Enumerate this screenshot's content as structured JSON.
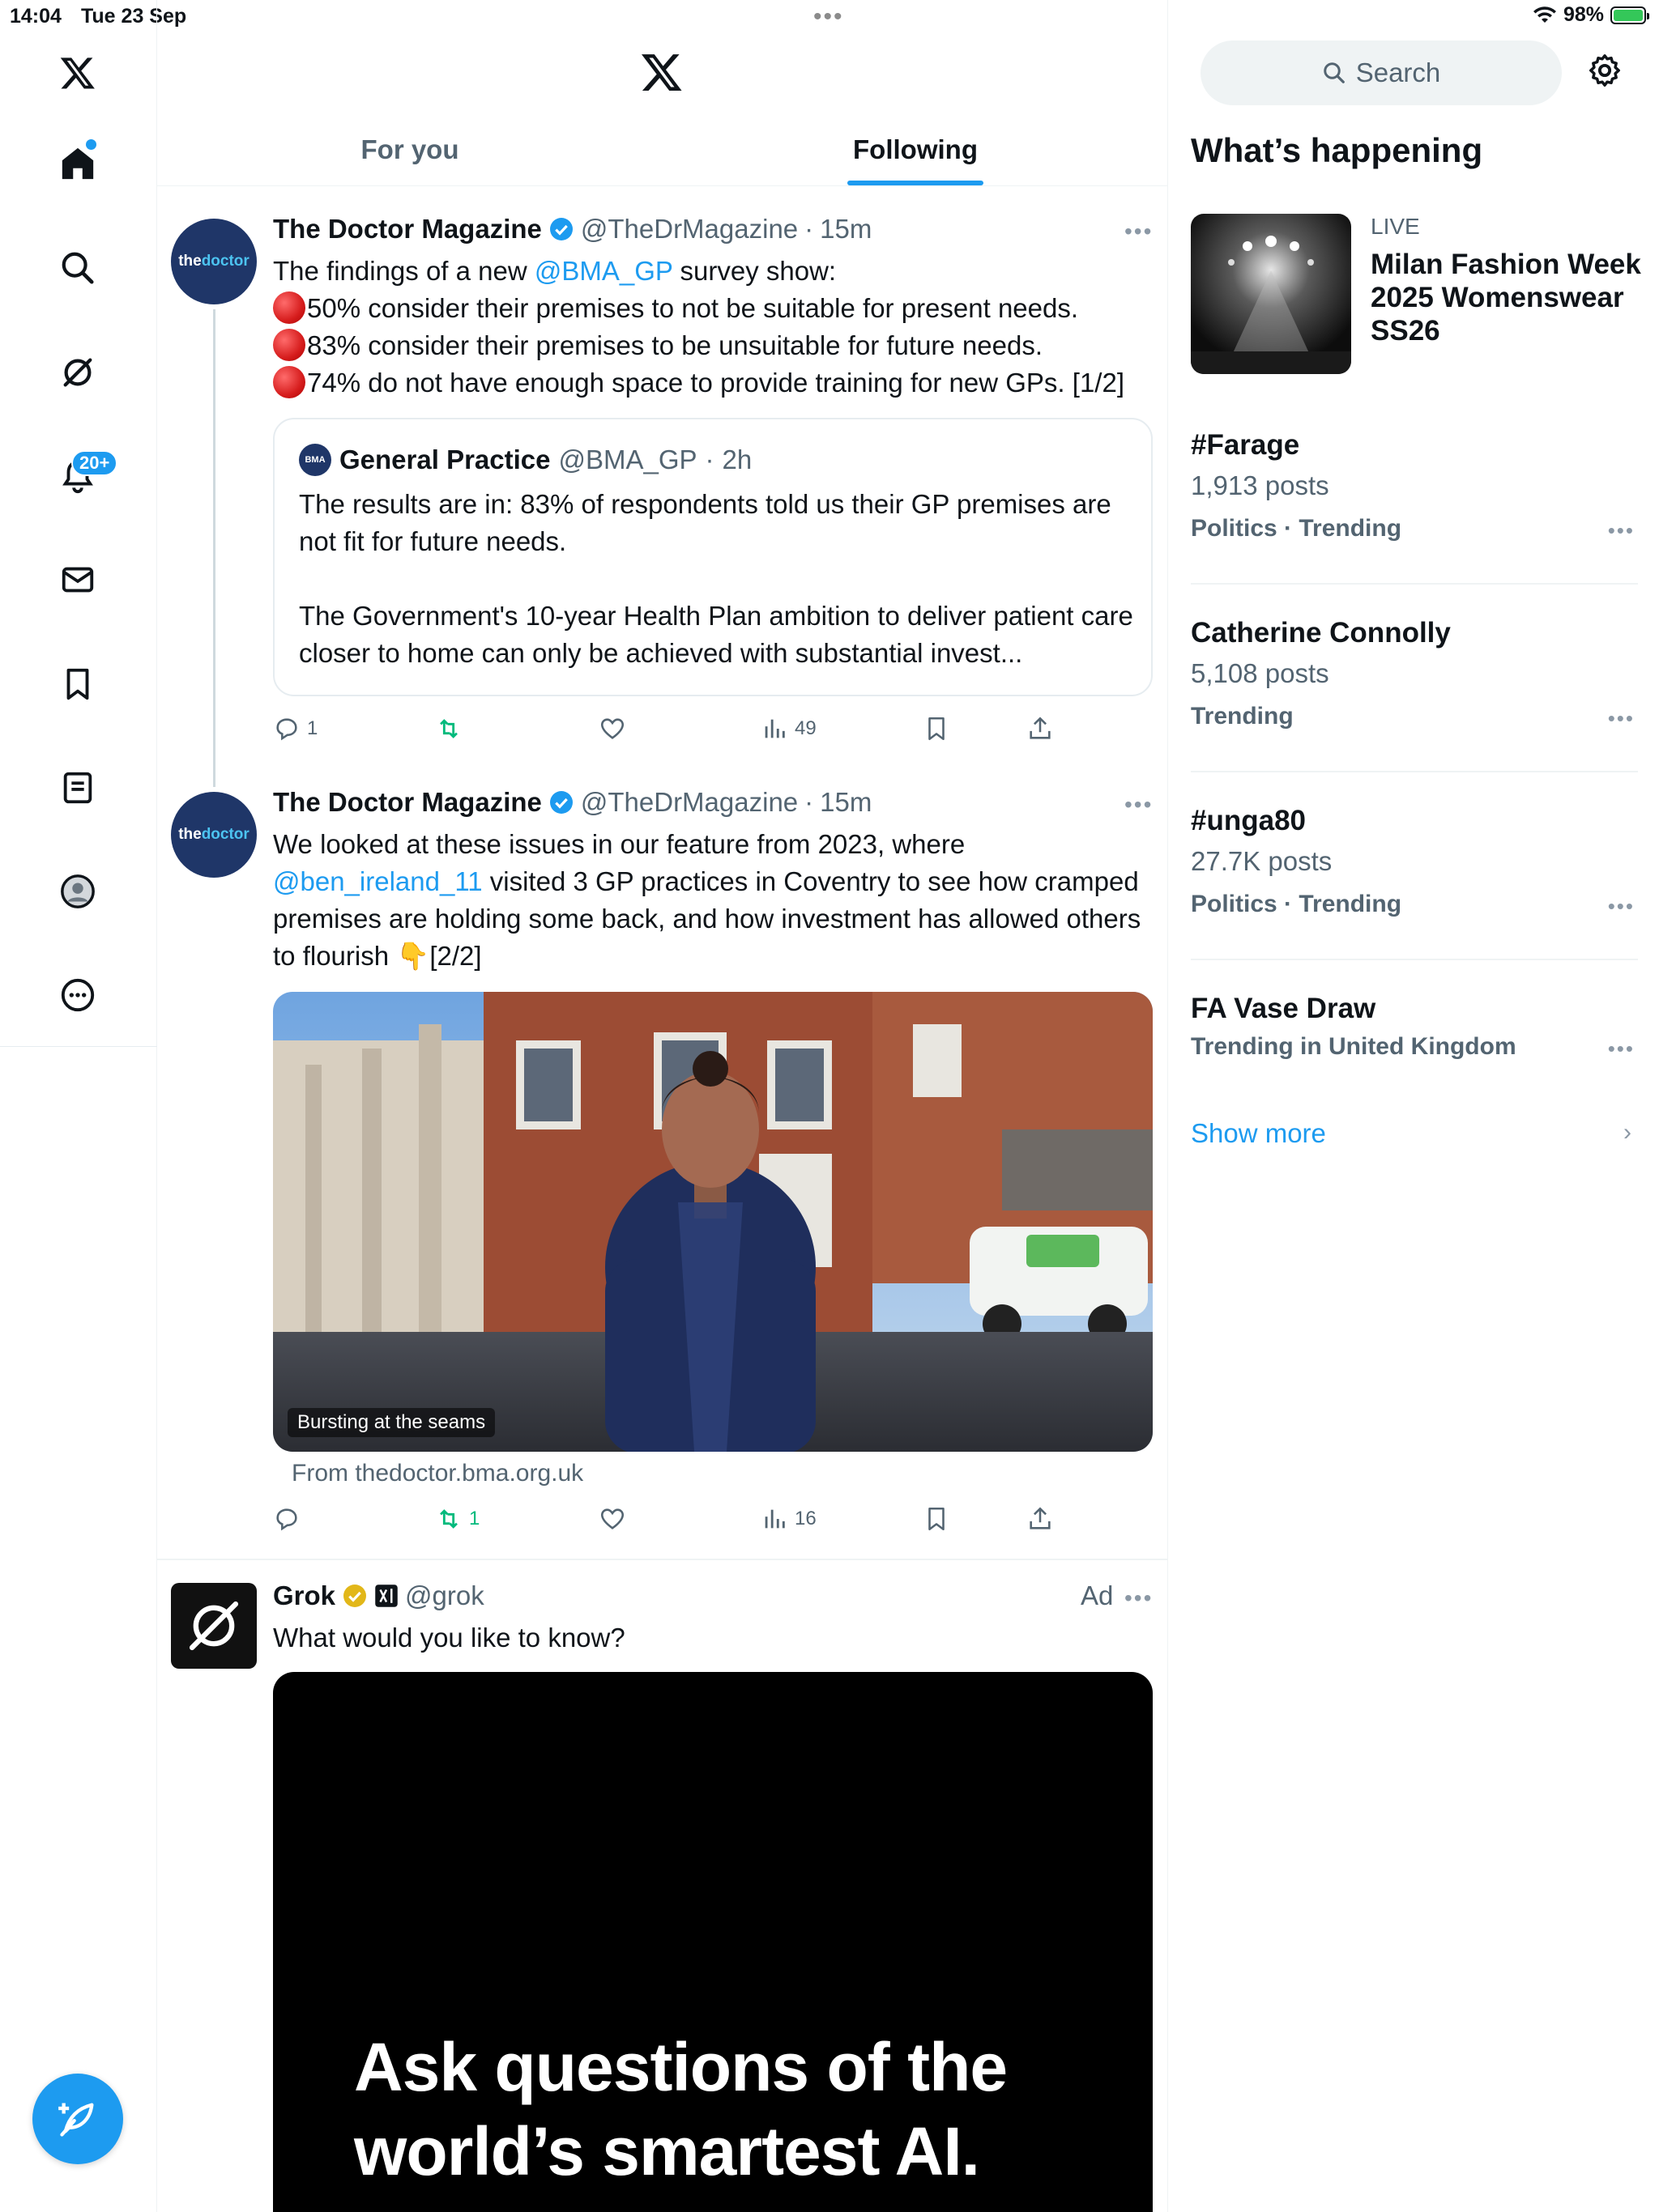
{
  "status": {
    "time": "14:04",
    "date": "Tue 23 Sep",
    "battery": "98%"
  },
  "nav": {
    "notifications_badge": "20+"
  },
  "tabs": [
    {
      "label": "For you"
    },
    {
      "label": "Following"
    }
  ],
  "tweet1": {
    "name": "The Doctor Magazine",
    "handle": "@TheDrMagazine",
    "time": "15m",
    "avatar_text_a": "the",
    "avatar_text_b": "doctor",
    "intro_a": "The findings of a new ",
    "intro_mention": "@BMA_GP",
    "intro_b": " survey show:",
    "line1": "50% consider their premises to not be suitable for present needs.",
    "line2": "83% consider their premises to be unsuitable for future needs.",
    "line3": "74% do not have enough space to provide training for new GPs. [1/2]",
    "quote": {
      "logo": "BMA",
      "name": "General Practice",
      "handle": "@BMA_GP",
      "time": "2h",
      "para1": "The results are in: 83% of respondents told us their GP premises are not fit for future needs.",
      "para2": "The Government's 10-year Health Plan ambition to deliver patient care closer to home can only be achieved with substantial invest..."
    },
    "replies": "1",
    "views": "49"
  },
  "tweet2": {
    "name": "The Doctor Magazine",
    "handle": "@TheDrMagazine",
    "time": "15m",
    "text_a": "We looked at these issues in our feature from 2023, where ",
    "mention": "@ben_ireland_11",
    "text_b": " visited 3 GP practices in Coventry to see how cramped premises are holding some back, and how investment has allowed others to flourish 👇[2/2]",
    "image_caption": "Bursting at the seams",
    "source": "From thedoctor.bma.org.uk",
    "reposts": "1",
    "views": "16"
  },
  "ad": {
    "name": "Grok",
    "handle": "@grok",
    "label": "Ad",
    "text": "What would you like to know?",
    "headline_1": "Ask questions of the",
    "headline_2": "world’s smartest AI."
  },
  "sidebar": {
    "search_placeholder": "Search",
    "title": "What’s happening",
    "live": {
      "label": "LIVE",
      "title": "Milan Fashion Week 2025 Womenswear SS26"
    },
    "trends": [
      {
        "title": "#Farage",
        "posts": "1,913 posts",
        "category": "Politics · Trending"
      },
      {
        "title": "Catherine Connolly",
        "posts": "5,108 posts",
        "category": "Trending"
      },
      {
        "title": "#unga80",
        "posts": "27.7K posts",
        "category": "Politics · Trending"
      },
      {
        "title": "FA Vase Draw",
        "posts": "",
        "category": "Trending in United Kingdom"
      }
    ],
    "show_more": "Show more"
  },
  "colors": {
    "accent": "#1d9bf0",
    "repost_green": "#00ba7c",
    "text_secondary": "#536471"
  },
  "icons": [
    "x-logo-icon",
    "home-icon",
    "search-icon",
    "grok-icon",
    "notifications-icon",
    "messages-icon",
    "bookmarks-icon",
    "lists-icon",
    "profile-icon",
    "more-icon",
    "compose-icon",
    "gear-icon"
  ]
}
